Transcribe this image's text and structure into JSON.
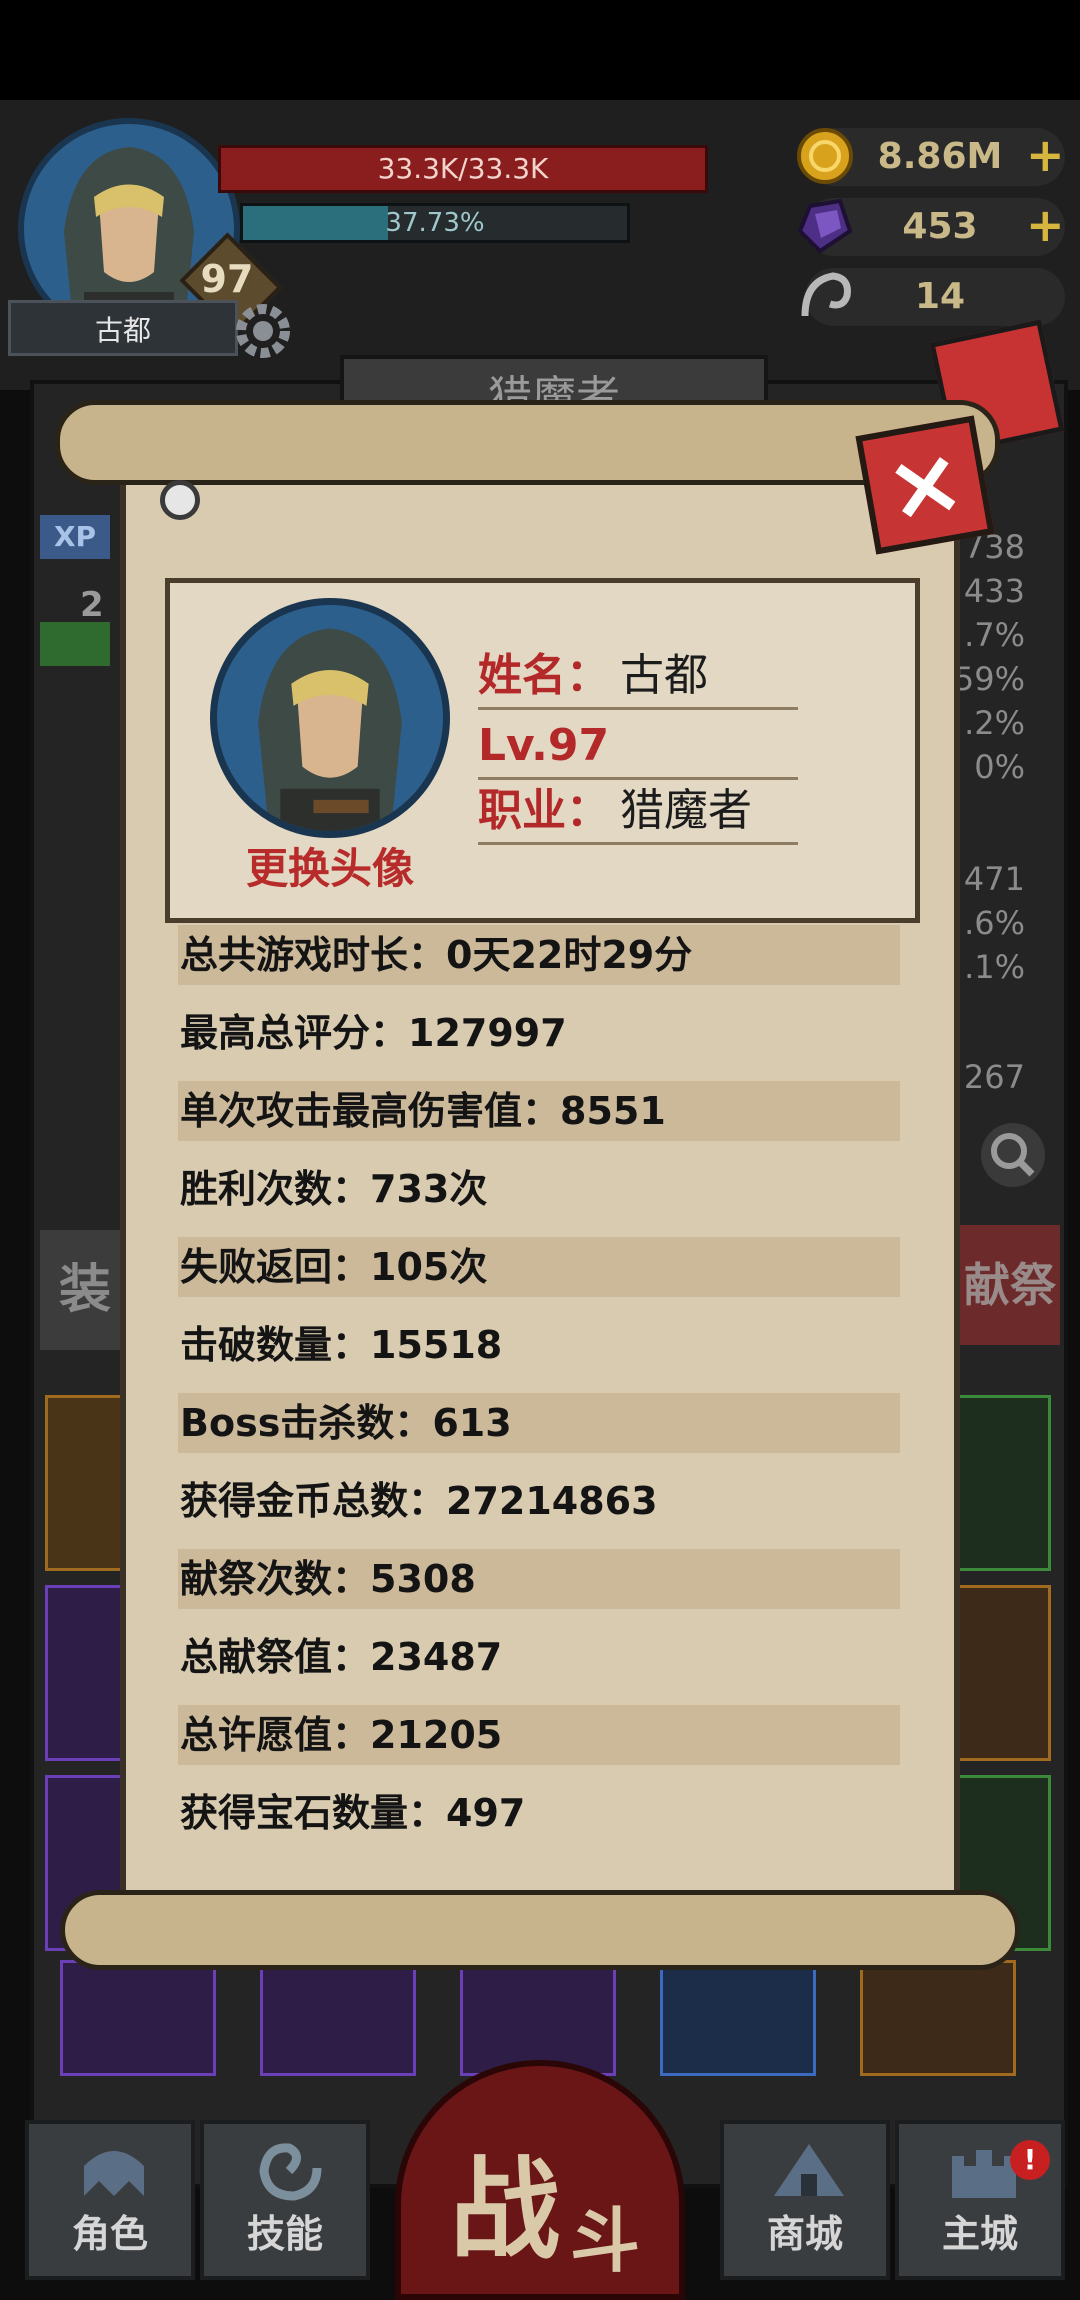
{
  "hud": {
    "player_name": "古都",
    "level": "97",
    "hp_text": "33.3K/33.3K",
    "xp_text": "37.73%",
    "xp_fraction": 0.3773,
    "gold": "8.86M",
    "gems": "453",
    "keys": "14",
    "plus": "+",
    "hp_color": "#8a1d1d",
    "xp_color": "#2c6f7c"
  },
  "background": {
    "class_banner": "猎魔者",
    "right_stats": [
      "738",
      "433",
      ".7%",
      "59%",
      ".2%",
      "0%",
      "471",
      ".6%",
      ".1%",
      "267"
    ],
    "equip_tab": "装",
    "offer_tab": "献祭",
    "xp_chip": "XP",
    "chip_two": "2"
  },
  "dialog": {
    "close_label": "×",
    "change_avatar": "更换头像",
    "name_label": "姓名：",
    "name_value": "古都",
    "level_label": "Lv.",
    "level_value": "97",
    "job_label": "职业：",
    "job_value": "猎魔者",
    "stats": [
      {
        "label": "总共游戏时长：",
        "value": "0天22时29分"
      },
      {
        "label": "最高总评分：",
        "value": "127997"
      },
      {
        "label": "单次攻击最高伤害值：",
        "value": "8551"
      },
      {
        "label": "胜利次数：",
        "value": "733次"
      },
      {
        "label": "失败返回：",
        "value": "105次"
      },
      {
        "label": "击破数量：",
        "value": "15518"
      },
      {
        "label": "Boss击杀数：",
        "value": "613"
      },
      {
        "label": "获得金币总数：",
        "value": "27214863"
      },
      {
        "label": "献祭次数：",
        "value": "5308"
      },
      {
        "label": "总献祭值：",
        "value": "23487"
      },
      {
        "label": "总许愿值：",
        "value": "21205"
      },
      {
        "label": "获得宝石数量：",
        "value": "497"
      }
    ]
  },
  "nav": {
    "role": "角色",
    "skill": "技能",
    "battle_1": "战",
    "battle_2": "斗",
    "shop": "商城",
    "main": "主城",
    "alert": "!"
  }
}
